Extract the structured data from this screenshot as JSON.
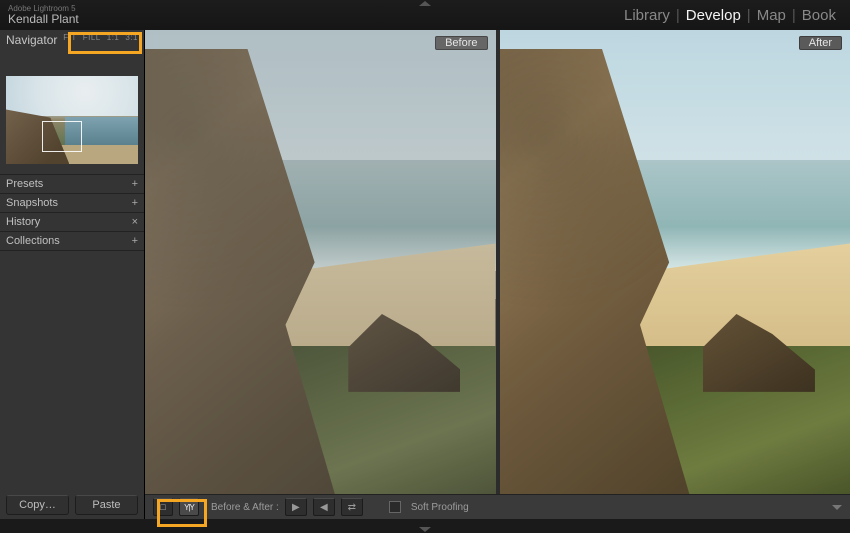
{
  "identity": {
    "app_name": "Adobe Lightroom 5",
    "user_name": "Kendall Plant"
  },
  "modules": {
    "items": [
      "Library",
      "Develop",
      "Map",
      "Book"
    ],
    "active": "Develop"
  },
  "navigator": {
    "label": "Navigator",
    "zoom_levels": [
      "FIT",
      "FILL",
      "1:1",
      "3:1"
    ]
  },
  "left_panels": [
    {
      "label": "Presets",
      "mark": "+"
    },
    {
      "label": "Snapshots",
      "mark": "+"
    },
    {
      "label": "History",
      "mark": "×"
    },
    {
      "label": "Collections",
      "mark": "+"
    }
  ],
  "left_buttons": {
    "copy": "Copy…",
    "paste": "Paste"
  },
  "compare": {
    "before_label": "Before",
    "after_label": "After"
  },
  "toolbar": {
    "before_after_label": "Before & After :",
    "soft_proofing_label": "Soft Proofing"
  },
  "highlights": {
    "zoom_group": true,
    "view_mode_group": true
  }
}
